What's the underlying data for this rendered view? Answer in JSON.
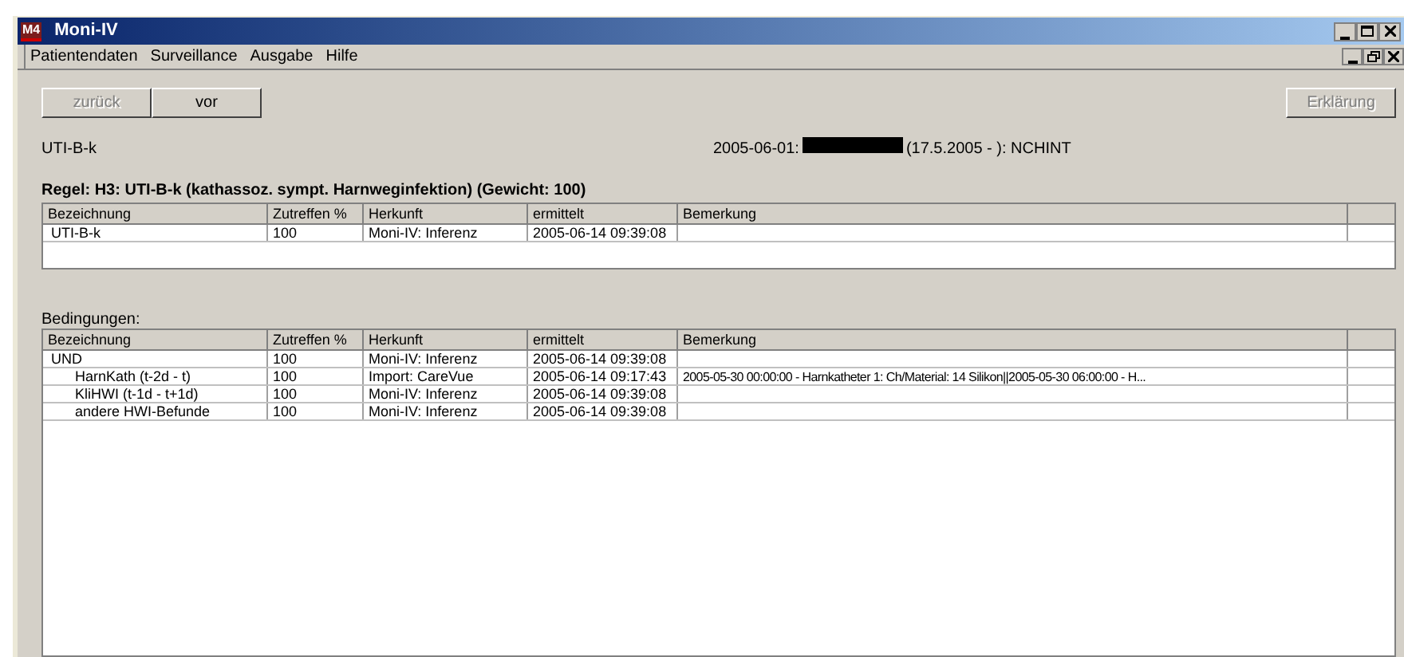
{
  "window": {
    "title": "Moni-IV",
    "icon_text": "M4"
  },
  "menu": [
    "Patientendaten",
    "Surveillance",
    "Ausgabe",
    "Hilfe"
  ],
  "toolbar": {
    "buttons": [
      {
        "label": "zurück",
        "disabled": true
      },
      {
        "label": "vor",
        "disabled": false
      }
    ],
    "explain_button": {
      "label": "Erklärung",
      "disabled": true
    }
  },
  "subject": "UTI-B-k",
  "patient": {
    "date": "2005-06-01:",
    "redacted": true,
    "info": "(17.5.2005 - ): NCHINT"
  },
  "rule_title": "Regel: H3: UTI-B-k (kathassoz. sympt. Harnweginfektion) (Gewicht: 100)",
  "result_columns": [
    "Bezeichnung",
    "Zutreffen %",
    "Herkunft",
    "ermittelt",
    "Bemerkung"
  ],
  "result_rows": [
    {
      "name": "UTI-B-k",
      "score": "100",
      "source": "Moni-IV: Inferenz",
      "date": "2005-06-14 09:39:08"
    }
  ],
  "conditions_label": "Bedingungen:",
  "condition_columns": [
    "Bezeichnung",
    "Zutreffen %",
    "Herkunft",
    "ermittelt",
    "Bemerkung"
  ],
  "condition_rows": [
    {
      "name": "UND",
      "score": "100",
      "source": "Moni-IV: Inferenz",
      "date": "2005-06-14 09:39:08",
      "children": [
        {
          "name": "HarnKath (t-2d - t)",
          "score": "100",
          "source": "Import: CareVue",
          "date": "2005-06-14 09:17:43",
          "remark": "2005-05-30 00:00:00 - Harnkatheter 1: Ch/Material: 14 Silikon||2005-05-30 06:00:00 - H..."
        },
        {
          "name": "KliHWI (t-1d - t+1d)",
          "score": "100",
          "source": "Moni-IV: Inferenz",
          "date": "2005-06-14 09:39:08"
        },
        {
          "name": "andere HWI-Befunde",
          "score": "100",
          "source": "Moni-IV: Inferenz",
          "date": "2005-06-14 09:39:08"
        }
      ]
    }
  ]
}
